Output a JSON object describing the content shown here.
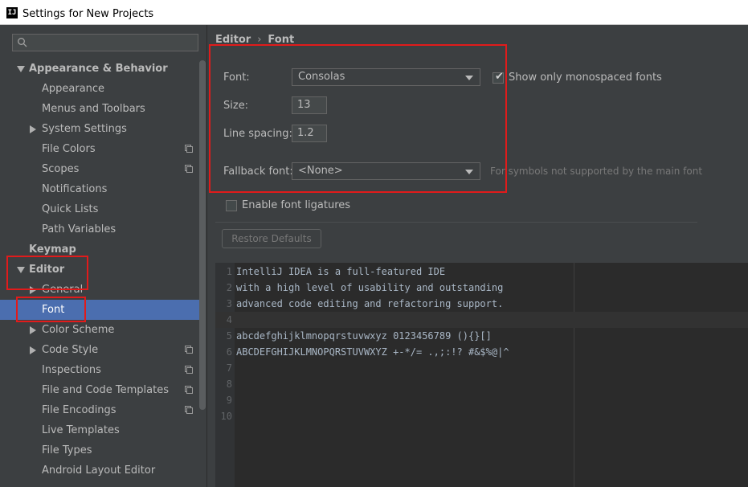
{
  "window": {
    "title": "Settings for New Projects",
    "app_icon_text": "IJ"
  },
  "sidebar": {
    "search_placeholder": "",
    "items": [
      {
        "label": "Appearance & Behavior",
        "arrow": "down",
        "bold": true
      },
      {
        "label": "Appearance"
      },
      {
        "label": "Menus and Toolbars"
      },
      {
        "label": "System Settings",
        "arrow": "right"
      },
      {
        "label": "File Colors",
        "copy": true
      },
      {
        "label": "Scopes",
        "copy": true
      },
      {
        "label": "Notifications"
      },
      {
        "label": "Quick Lists"
      },
      {
        "label": "Path Variables"
      },
      {
        "label": "Keymap",
        "bold": true
      },
      {
        "label": "Editor",
        "arrow": "down",
        "bold": true
      },
      {
        "label": "General",
        "arrow": "right"
      },
      {
        "label": "Font",
        "selected": true
      },
      {
        "label": "Color Scheme",
        "arrow": "right"
      },
      {
        "label": "Code Style",
        "arrow": "right",
        "copy": true
      },
      {
        "label": "Inspections",
        "copy": true
      },
      {
        "label": "File and Code Templates",
        "copy": true
      },
      {
        "label": "File Encodings",
        "copy": true
      },
      {
        "label": "Live Templates"
      },
      {
        "label": "File Types"
      },
      {
        "label": "Android Layout Editor"
      }
    ]
  },
  "breadcrumb": {
    "part1": "Editor",
    "separator": "›",
    "part2": "Font"
  },
  "form": {
    "font_label": "Font:",
    "font_value": "Consolas",
    "monospace_label": "Show only monospaced fonts",
    "monospace_checked": true,
    "size_label": "Size:",
    "size_value": "13",
    "line_spacing_label": "Line spacing:",
    "line_spacing_value": "1.2",
    "fallback_label": "Fallback font:",
    "fallback_value": "<None>",
    "fallback_hint": "For symbols not supported by the main font",
    "ligatures_label": "Enable font ligatures",
    "ligatures_checked": false,
    "restore_button": "Restore Defaults"
  },
  "preview": {
    "lines": [
      {
        "n": "1",
        "text": "IntelliJ IDEA is a full-featured IDE"
      },
      {
        "n": "2",
        "text": "with a high level of usability and outstanding"
      },
      {
        "n": "3",
        "text": "advanced code editing and refactoring support."
      },
      {
        "n": "4",
        "text": ""
      },
      {
        "n": "5",
        "text": "abcdefghijklmnopqrstuvwxyz 0123456789 (){}[]"
      },
      {
        "n": "6",
        "text": "ABCDEFGHIJKLMNOPQRSTUVWXYZ +-*/= .,;:!? #&$%@|^"
      },
      {
        "n": "7",
        "text": ""
      },
      {
        "n": "8",
        "text": ""
      },
      {
        "n": "9",
        "text": ""
      },
      {
        "n": "10",
        "text": ""
      }
    ]
  },
  "colors": {
    "background": "#3c3f41",
    "selection": "#4b6eaf",
    "editor_bg": "#2b2b2b",
    "annotation_red": "#e11b1b"
  }
}
